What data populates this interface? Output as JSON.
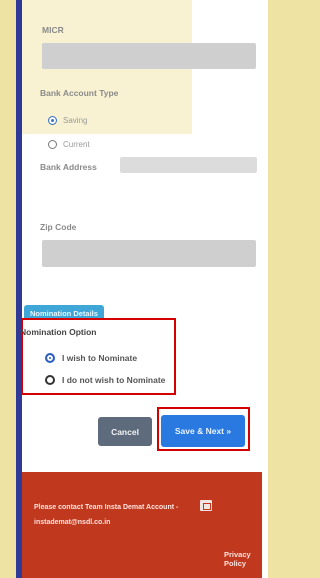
{
  "bank": {
    "micr_label": "MICR",
    "account_type_label": "Bank Account Type",
    "account_types": [
      {
        "label": "Saving",
        "selected": true
      },
      {
        "label": "Current",
        "selected": false
      }
    ],
    "address_label": "Bank Address",
    "zip_label": "Zip Code"
  },
  "nomination": {
    "section_badge": "Nomination Details",
    "option_title": "Nomination Option",
    "options": [
      {
        "label": "I wish to Nominate",
        "selected": true
      },
      {
        "label": "I do not wish to Nominate",
        "selected": false
      }
    ]
  },
  "actions": {
    "cancel_label": "Cancel",
    "save_label": "Save & Next »"
  },
  "footer": {
    "contact_text": "Please contact Team Insta Demat Account -",
    "email": "instademat@nsdl.co.in",
    "privacy_label": "Privacy Policy"
  },
  "colors": {
    "primary": "#2a79e0",
    "highlight_red": "#d40000",
    "footer_red": "#c0391f",
    "badge_blue": "#3ea7d8"
  }
}
